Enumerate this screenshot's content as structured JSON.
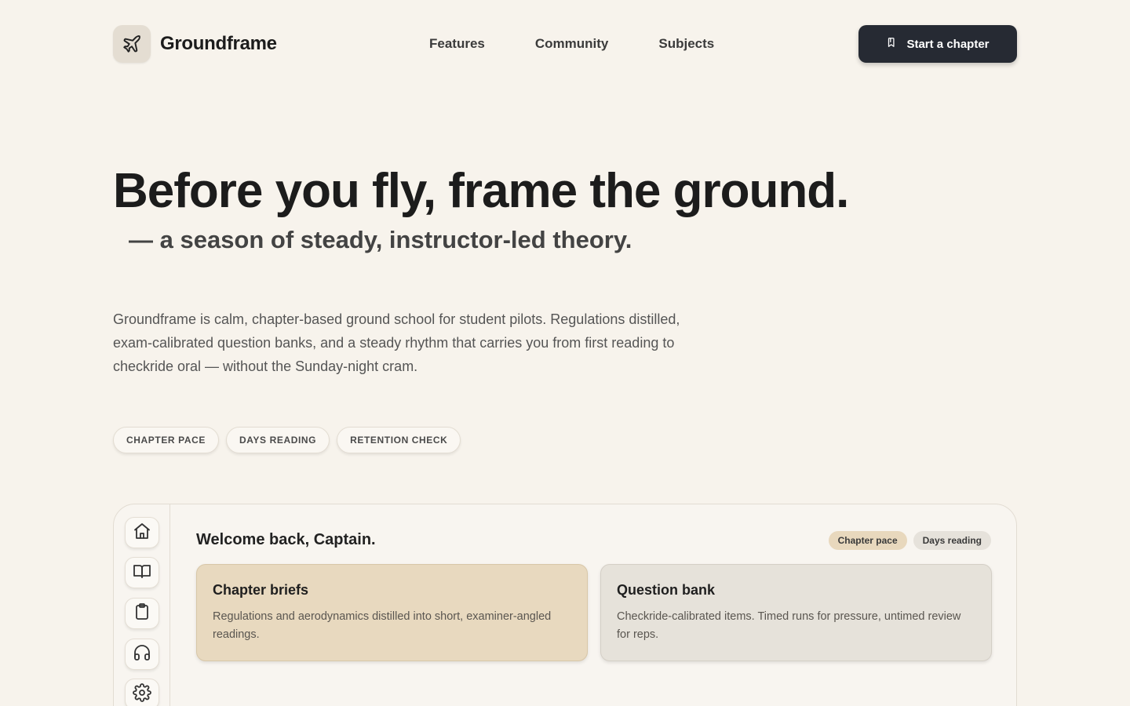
{
  "brand": {
    "name": "Groundframe",
    "logo_icon": "plane-icon"
  },
  "nav": {
    "items": [
      {
        "label": "Features"
      },
      {
        "label": "Community"
      },
      {
        "label": "Subjects"
      }
    ]
  },
  "cta": {
    "label": "Start a chapter",
    "icon": "bookmark-icon"
  },
  "hero": {
    "title": "Before you fly, frame the ground.",
    "subtitle": "— a season of steady, instructor-led theory.",
    "description": "Groundframe is calm, chapter-based ground school for student pilots. Regulations distilled, exam-calibrated question banks, and a steady rhythm that carries you from first reading to checkride oral — without the Sunday-night cram."
  },
  "chips": [
    {
      "label": "CHAPTER PACE"
    },
    {
      "label": "DAYS READING"
    },
    {
      "label": "RETENTION CHECK"
    }
  ],
  "dashboard": {
    "welcome": "Welcome back, Captain.",
    "tags": [
      {
        "label": "Chapter pace"
      },
      {
        "label": "Days reading"
      }
    ],
    "rail": [
      "home-icon",
      "book-icon",
      "clipboard-icon",
      "headphones-icon",
      "settings-icon"
    ],
    "cards": [
      {
        "title": "Chapter briefs",
        "body": "Regulations and aerodynamics distilled into short, examiner-angled readings."
      },
      {
        "title": "Question bank",
        "body": "Checkride-calibrated items. Timed runs for pressure, untimed review for reps."
      }
    ]
  },
  "colors": {
    "background": "#f7f3ec",
    "cta": "#262a33",
    "accent_tan": "#e8d9bf",
    "neutral_card": "#e6e2da"
  }
}
